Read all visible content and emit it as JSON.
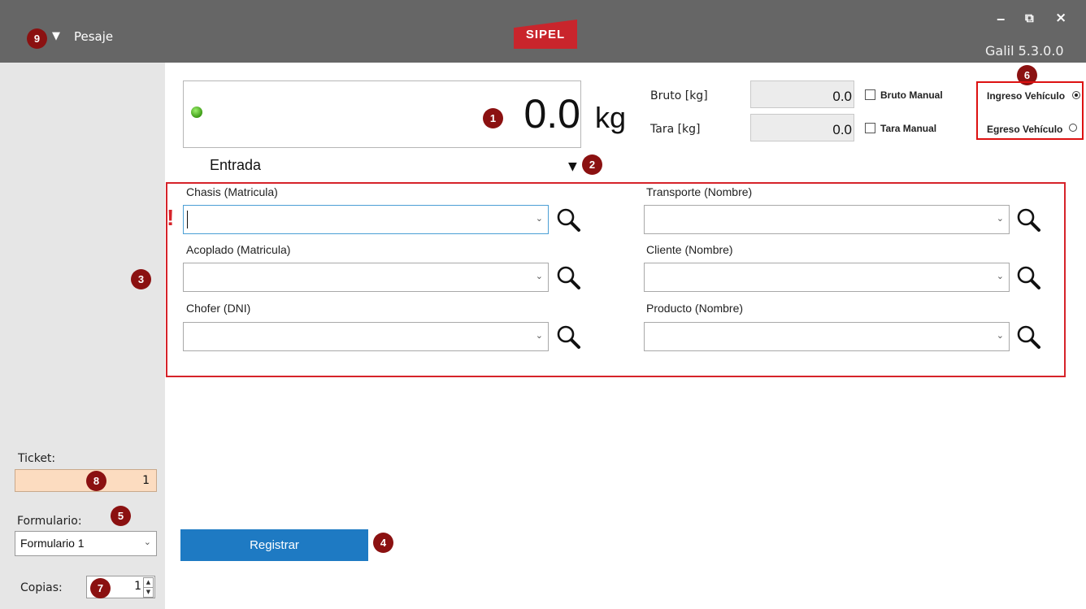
{
  "app": {
    "menu_label": "Pesaje",
    "logo_text": "SIPEL",
    "version": "Galil 5.3.0.0",
    "window_controls": {
      "minimize": "‒",
      "restore": "⧉",
      "close": "×"
    }
  },
  "scale": {
    "weight": "0.0",
    "unit": "kg",
    "bruto_label": "Bruto [kg]",
    "bruto_value": "0.0",
    "tara_label": "Tara [kg]",
    "tara_value": "0.0",
    "bruto_manual_label": "Bruto Manual",
    "tara_manual_label": "Tara Manual",
    "status_color": "#4caf22"
  },
  "direction": {
    "ingreso_label": "Ingreso Vehículo",
    "egreso_label": "Egreso Vehículo",
    "selected": "ingreso"
  },
  "mode": {
    "label": "Entrada",
    "arrow": "▼"
  },
  "form": {
    "validation_mark": "!",
    "fields": {
      "chasis": "Chasis (Matricula)",
      "acoplado": "Acoplado (Matricula)",
      "chofer": "Chofer (DNI)",
      "transporte": "Transporte (Nombre)",
      "cliente": "Cliente (Nombre)",
      "producto": "Producto (Nombre)"
    }
  },
  "sidebar": {
    "ticket_label": "Ticket:",
    "ticket_value": "1",
    "formulario_label": "Formulario:",
    "formulario_value": "Formulario 1",
    "copias_label": "Copias:",
    "copias_value": "1"
  },
  "actions": {
    "register_label": "Registrar"
  },
  "markers": {
    "m1": "1",
    "m2": "2",
    "m3": "3",
    "m4": "4",
    "m5": "5",
    "m6": "6",
    "m7": "7",
    "m8": "8",
    "m9": "9"
  },
  "colors": {
    "header_bg": "#666666",
    "accent_blue": "#1e7ac3",
    "highlight_red": "#d6232a",
    "ticket_bg": "#fcdcc0"
  }
}
